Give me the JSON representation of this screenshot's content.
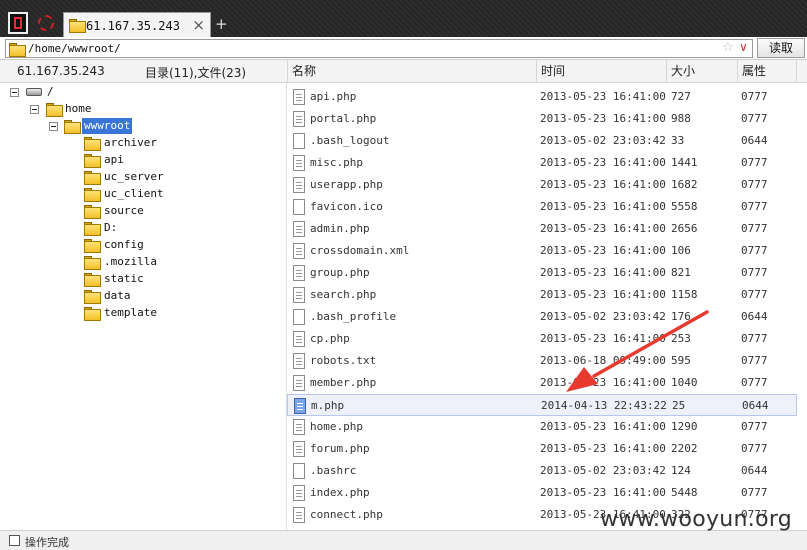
{
  "tab": {
    "label": "61.167.35.243",
    "close": "×",
    "new": "+"
  },
  "address": {
    "path": "/home/wwwroot/",
    "star": "☆",
    "dropdown": "∨",
    "read_button": "读取"
  },
  "header": {
    "host": "61.167.35.243",
    "summary": "目录(11),文件(23)",
    "columns": {
      "name": "名称",
      "time": "时间",
      "size": "大小",
      "attr": "属性"
    }
  },
  "tree": {
    "root": "/",
    "home": "home",
    "wwwroot": "wwwroot",
    "children": [
      "archiver",
      "api",
      "uc_server",
      "uc_client",
      "source",
      "D:",
      "config",
      ".mozilla",
      "static",
      "data",
      "template"
    ]
  },
  "files": [
    {
      "name": "api.php",
      "time": "2013-05-23 16:41:00",
      "size": "727",
      "attr": "0777",
      "icon": "doc"
    },
    {
      "name": "portal.php",
      "time": "2013-05-23 16:41:00",
      "size": "988",
      "attr": "0777",
      "icon": "doc"
    },
    {
      "name": ".bash_logout",
      "time": "2013-05-02 23:03:42",
      "size": "33",
      "attr": "0644",
      "icon": "plain"
    },
    {
      "name": "misc.php",
      "time": "2013-05-23 16:41:00",
      "size": "1441",
      "attr": "0777",
      "icon": "doc"
    },
    {
      "name": "userapp.php",
      "time": "2013-05-23 16:41:00",
      "size": "1682",
      "attr": "0777",
      "icon": "doc"
    },
    {
      "name": "favicon.ico",
      "time": "2013-05-23 16:41:00",
      "size": "5558",
      "attr": "0777",
      "icon": "plain"
    },
    {
      "name": "admin.php",
      "time": "2013-05-23 16:41:00",
      "size": "2656",
      "attr": "0777",
      "icon": "doc"
    },
    {
      "name": "crossdomain.xml",
      "time": "2013-05-23 16:41:00",
      "size": "106",
      "attr": "0777",
      "icon": "doc"
    },
    {
      "name": "group.php",
      "time": "2013-05-23 16:41:00",
      "size": "821",
      "attr": "0777",
      "icon": "doc"
    },
    {
      "name": "search.php",
      "time": "2013-05-23 16:41:00",
      "size": "1158",
      "attr": "0777",
      "icon": "doc"
    },
    {
      "name": ".bash_profile",
      "time": "2013-05-02 23:03:42",
      "size": "176",
      "attr": "0644",
      "icon": "plain"
    },
    {
      "name": "cp.php",
      "time": "2013-05-23 16:41:00",
      "size": "253",
      "attr": "0777",
      "icon": "doc"
    },
    {
      "name": "robots.txt",
      "time": "2013-06-18 09:49:00",
      "size": "595",
      "attr": "0777",
      "icon": "doc"
    },
    {
      "name": "member.php",
      "time": "2013-05-23 16:41:00",
      "size": "1040",
      "attr": "0777",
      "icon": "doc"
    },
    {
      "name": "m.php",
      "time": "2014-04-13 22:43:22",
      "size": "25",
      "attr": "0644",
      "icon": "hl",
      "selected": true
    },
    {
      "name": "home.php",
      "time": "2013-05-23 16:41:00",
      "size": "1290",
      "attr": "0777",
      "icon": "doc"
    },
    {
      "name": "forum.php",
      "time": "2013-05-23 16:41:00",
      "size": "2202",
      "attr": "0777",
      "icon": "doc"
    },
    {
      "name": ".bashrc",
      "time": "2013-05-02 23:03:42",
      "size": "124",
      "attr": "0644",
      "icon": "plain"
    },
    {
      "name": "index.php",
      "time": "2013-05-23 16:41:00",
      "size": "5448",
      "attr": "0777",
      "icon": "doc"
    },
    {
      "name": "connect.php",
      "time": "2013-05-23 16:41:00",
      "size": "322",
      "attr": "0777",
      "icon": "doc"
    }
  ],
  "status": {
    "text": "操作完成"
  },
  "watermark": "www.wooyun.org",
  "colors": {
    "accent": "#3875d7",
    "arrow": "#e8392f",
    "selected_row": "#eef1fb"
  }
}
